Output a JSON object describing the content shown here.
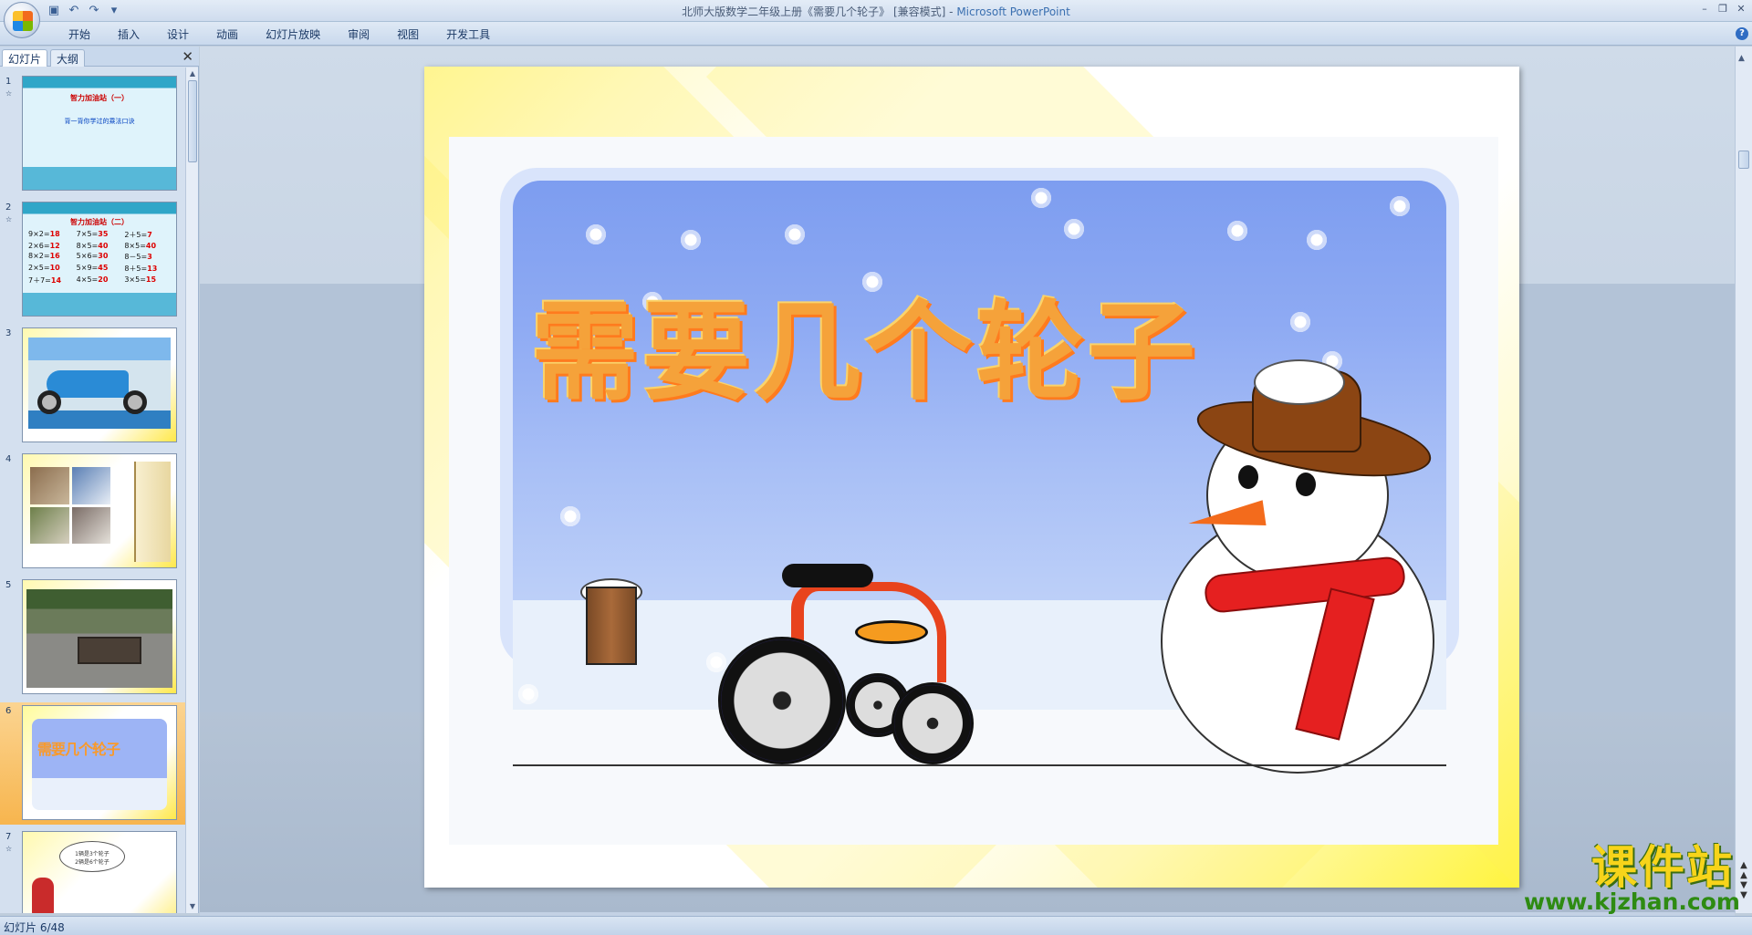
{
  "window": {
    "title": "北师大版数学二年级上册《需要几个轮子》 [兼容模式]",
    "app_name": "Microsoft PowerPoint",
    "title_separator": " - "
  },
  "quick_access": {
    "icons": [
      "save-icon",
      "undo-icon",
      "redo-icon",
      "customize-icon"
    ]
  },
  "ribbon": {
    "tabs": [
      "开始",
      "插入",
      "设计",
      "动画",
      "幻灯片放映",
      "审阅",
      "视图",
      "开发工具"
    ]
  },
  "left_pane": {
    "tabs": [
      "幻灯片",
      "大纲"
    ],
    "slides": [
      {
        "num": "1",
        "title": "智力加油站（一）",
        "subtitle": "背一背你学过的乘法口诀"
      },
      {
        "num": "2",
        "title": "智力加油站（二）",
        "equations": [
          {
            "q": "9×2=",
            "a": "18"
          },
          {
            "q": "7×5=",
            "a": "35"
          },
          {
            "q": "2＋5=",
            "a": "7"
          },
          {
            "q": "2×6=",
            "a": "12"
          },
          {
            "q": "8×5=",
            "a": "40"
          },
          {
            "q": "8×5=",
            "a": "40"
          },
          {
            "q": "8×2=",
            "a": "16"
          },
          {
            "q": "5×6=",
            "a": "30"
          },
          {
            "q": "8－5=",
            "a": "3"
          },
          {
            "q": "2×5=",
            "a": "10"
          },
          {
            "q": "5×9=",
            "a": "45"
          },
          {
            "q": "8＋5=",
            "a": "13"
          },
          {
            "q": "7＋7=",
            "a": "14"
          },
          {
            "q": "4×5=",
            "a": "20"
          },
          {
            "q": "3×5=",
            "a": "15"
          }
        ]
      },
      {
        "num": "3"
      },
      {
        "num": "4"
      },
      {
        "num": "5"
      },
      {
        "num": "6",
        "selected": true,
        "mini_title": "需要几个轮子"
      },
      {
        "num": "7",
        "cloud_lines": [
          "1辆是3个轮子",
          "2辆是6个轮子"
        ]
      }
    ]
  },
  "slide": {
    "title": "需要几个轮子"
  },
  "watermark": {
    "big": "课件站",
    "small": "www.kjzhan.com"
  },
  "statusbar": {
    "text": "幻灯片 6/48"
  },
  "colors": {
    "title_orange": "#f5a23a",
    "sky_blue": "#8eaaf3",
    "slide_yellow": "#fff43e",
    "selected_thumb": "#f7b54e",
    "scarf_red": "#e52020"
  }
}
